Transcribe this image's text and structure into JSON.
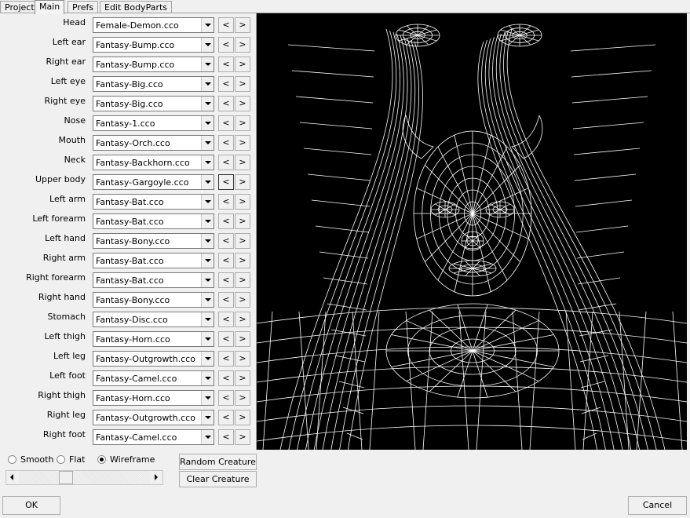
{
  "tabs": [
    {
      "label": "Project",
      "active": false
    },
    {
      "label": "Main",
      "active": true
    },
    {
      "label": "Prefs",
      "active": false
    },
    {
      "label": "Edit BodyParts",
      "active": false
    }
  ],
  "parts": [
    {
      "label": "Head",
      "value": "Female-Demon.cco"
    },
    {
      "label": "Left ear",
      "value": "Fantasy-Bump.cco"
    },
    {
      "label": "Right ear",
      "value": "Fantasy-Bump.cco"
    },
    {
      "label": "Left eye",
      "value": "Fantasy-Big.cco"
    },
    {
      "label": "Right eye",
      "value": "Fantasy-Big.cco"
    },
    {
      "label": "Nose",
      "value": "Fantasy-1.cco"
    },
    {
      "label": "Mouth",
      "value": "Fantasy-Orch.cco"
    },
    {
      "label": "Neck",
      "value": "Fantasy-Backhorn.cco"
    },
    {
      "label": "Upper body",
      "value": "Fantasy-Gargoyle.cco"
    },
    {
      "label": "Left arm",
      "value": "Fantasy-Bat.cco"
    },
    {
      "label": "Left forearm",
      "value": "Fantasy-Bat.cco"
    },
    {
      "label": "Left hand",
      "value": "Fantasy-Bony.cco"
    },
    {
      "label": "Right arm",
      "value": "Fantasy-Bat.cco"
    },
    {
      "label": "Right forearm",
      "value": "Fantasy-Bat.cco"
    },
    {
      "label": "Right hand",
      "value": "Fantasy-Bony.cco"
    },
    {
      "label": "Stomach",
      "value": "Fantasy-Disc.cco"
    },
    {
      "label": "Left thigh",
      "value": "Fantasy-Horn.cco"
    },
    {
      "label": "Left leg",
      "value": "Fantasy-Outgrowth.cco"
    },
    {
      "label": "Left foot",
      "value": "Fantasy-Camel.cco"
    },
    {
      "label": "Right thigh",
      "value": "Fantasy-Horn.cco"
    },
    {
      "label": "Right leg",
      "value": "Fantasy-Outgrowth.cco"
    },
    {
      "label": "Right foot",
      "value": "Fantasy-Camel.cco"
    }
  ],
  "nav": {
    "prev": "<",
    "next": ">"
  },
  "focused_prev_row": 8,
  "render_modes": [
    {
      "label": "Smooth",
      "selected": false
    },
    {
      "label": "Flat",
      "selected": false
    },
    {
      "label": "Wireframe",
      "selected": true
    }
  ],
  "slider": {
    "value_fraction": 0.34
  },
  "buttons": {
    "random": "Random Creature",
    "clear": "Clear Creature",
    "ok": "OK",
    "cancel": "Cancel"
  },
  "colors": {
    "viewport_bg": "#000000",
    "wire": "#ffffff"
  }
}
